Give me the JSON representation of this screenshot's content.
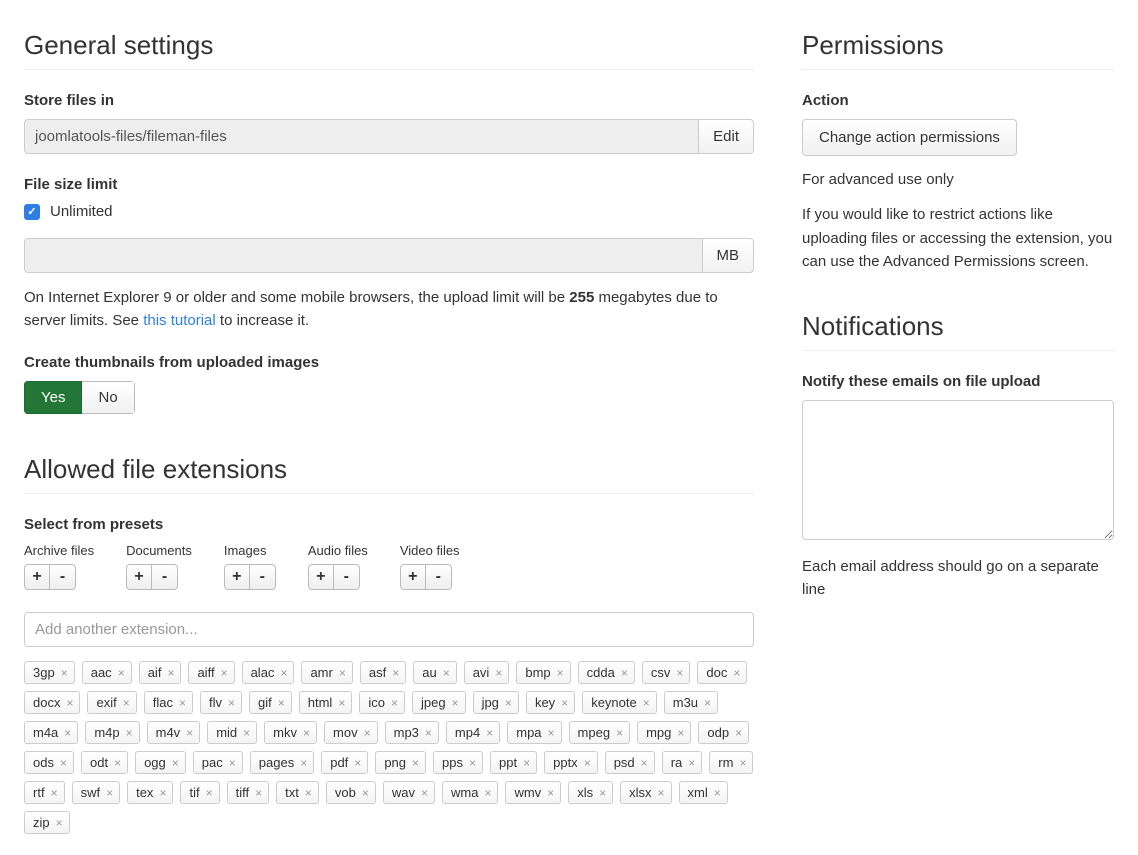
{
  "general": {
    "title": "General settings",
    "store_label": "Store files in",
    "store_value": "joomlatools-files/fileman-files",
    "edit_label": "Edit",
    "size_label": "File size limit",
    "unlimited_label": "Unlimited",
    "size_unit": "MB",
    "size_help_pre": "On Internet Explorer 9 or older and some mobile browsers, the upload limit will be ",
    "size_help_bold": "255",
    "size_help_mid": " megabytes due to server limits. See ",
    "size_help_link": "this tutorial",
    "size_help_post": " to increase it.",
    "thumb_label": "Create thumbnails from uploaded images",
    "yes": "Yes",
    "no": "No"
  },
  "extensions": {
    "title": "Allowed file extensions",
    "presets_label": "Select from presets",
    "presets": [
      "Archive files",
      "Documents",
      "Images",
      "Audio files",
      "Video files"
    ],
    "add_placeholder": "Add another extension...",
    "tags": [
      "3gp",
      "aac",
      "aif",
      "aiff",
      "alac",
      "amr",
      "asf",
      "au",
      "avi",
      "bmp",
      "cdda",
      "csv",
      "doc",
      "docx",
      "exif",
      "flac",
      "flv",
      "gif",
      "html",
      "ico",
      "jpeg",
      "jpg",
      "key",
      "keynote",
      "m3u",
      "m4a",
      "m4p",
      "m4v",
      "mid",
      "mkv",
      "mov",
      "mp3",
      "mp4",
      "mpa",
      "mpeg",
      "mpg",
      "odp",
      "ods",
      "odt",
      "ogg",
      "pac",
      "pages",
      "pdf",
      "png",
      "pps",
      "ppt",
      "pptx",
      "psd",
      "ra",
      "rm",
      "rtf",
      "swf",
      "tex",
      "tif",
      "tiff",
      "txt",
      "vob",
      "wav",
      "wma",
      "wmv",
      "xls",
      "xlsx",
      "xml",
      "zip"
    ]
  },
  "permissions": {
    "title": "Permissions",
    "action_label": "Action",
    "change_btn": "Change action permissions",
    "advanced_note": "For advanced use only",
    "restrict_note": "If you would like to restrict actions like uploading files or accessing the extension, you can use the Advanced Permissions screen."
  },
  "notifications": {
    "title": "Notifications",
    "notify_label": "Notify these emails on file upload",
    "notify_help": "Each email address should go on a separate line"
  }
}
